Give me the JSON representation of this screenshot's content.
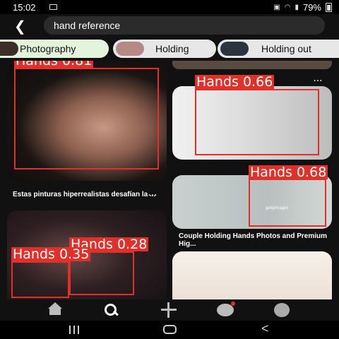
{
  "status_bar": {
    "time": "15:02",
    "battery": "79%"
  },
  "search": {
    "query": "hand reference"
  },
  "chips": [
    {
      "label": "Photography"
    },
    {
      "label": "Holding"
    },
    {
      "label": "Holding out"
    }
  ],
  "pins": [
    {
      "caption": "Estas pinturas hiperrealistas desafían la ..."
    },
    {
      "caption": "Couple Holding Hands Photos and Premium Hig..."
    }
  ],
  "pin_more_label": "...",
  "watermark": "gettyimages",
  "detections": [
    {
      "label": "Hands 0.81",
      "class": "Hands",
      "confidence": 0.81
    },
    {
      "label": "Hands 0.66",
      "class": "Hands",
      "confidence": 0.66
    },
    {
      "label": "Hands 0.68",
      "class": "Hands",
      "confidence": 0.68
    },
    {
      "label": "Hands 0.28",
      "class": "Hands",
      "confidence": 0.28
    },
    {
      "label": "Hands 0.35",
      "class": "Hands",
      "confidence": 0.35
    }
  ],
  "colors": {
    "detection": "#e0302a",
    "chip_active": "#e4f4dc",
    "background": "#111111"
  },
  "icons": {
    "back": "chevron-left-icon",
    "tabs": [
      "home-icon",
      "search-icon",
      "plus-icon",
      "chat-icon",
      "avatar"
    ],
    "nav": [
      "recent-apps-icon",
      "home-nav-icon",
      "back-nav-icon"
    ]
  }
}
